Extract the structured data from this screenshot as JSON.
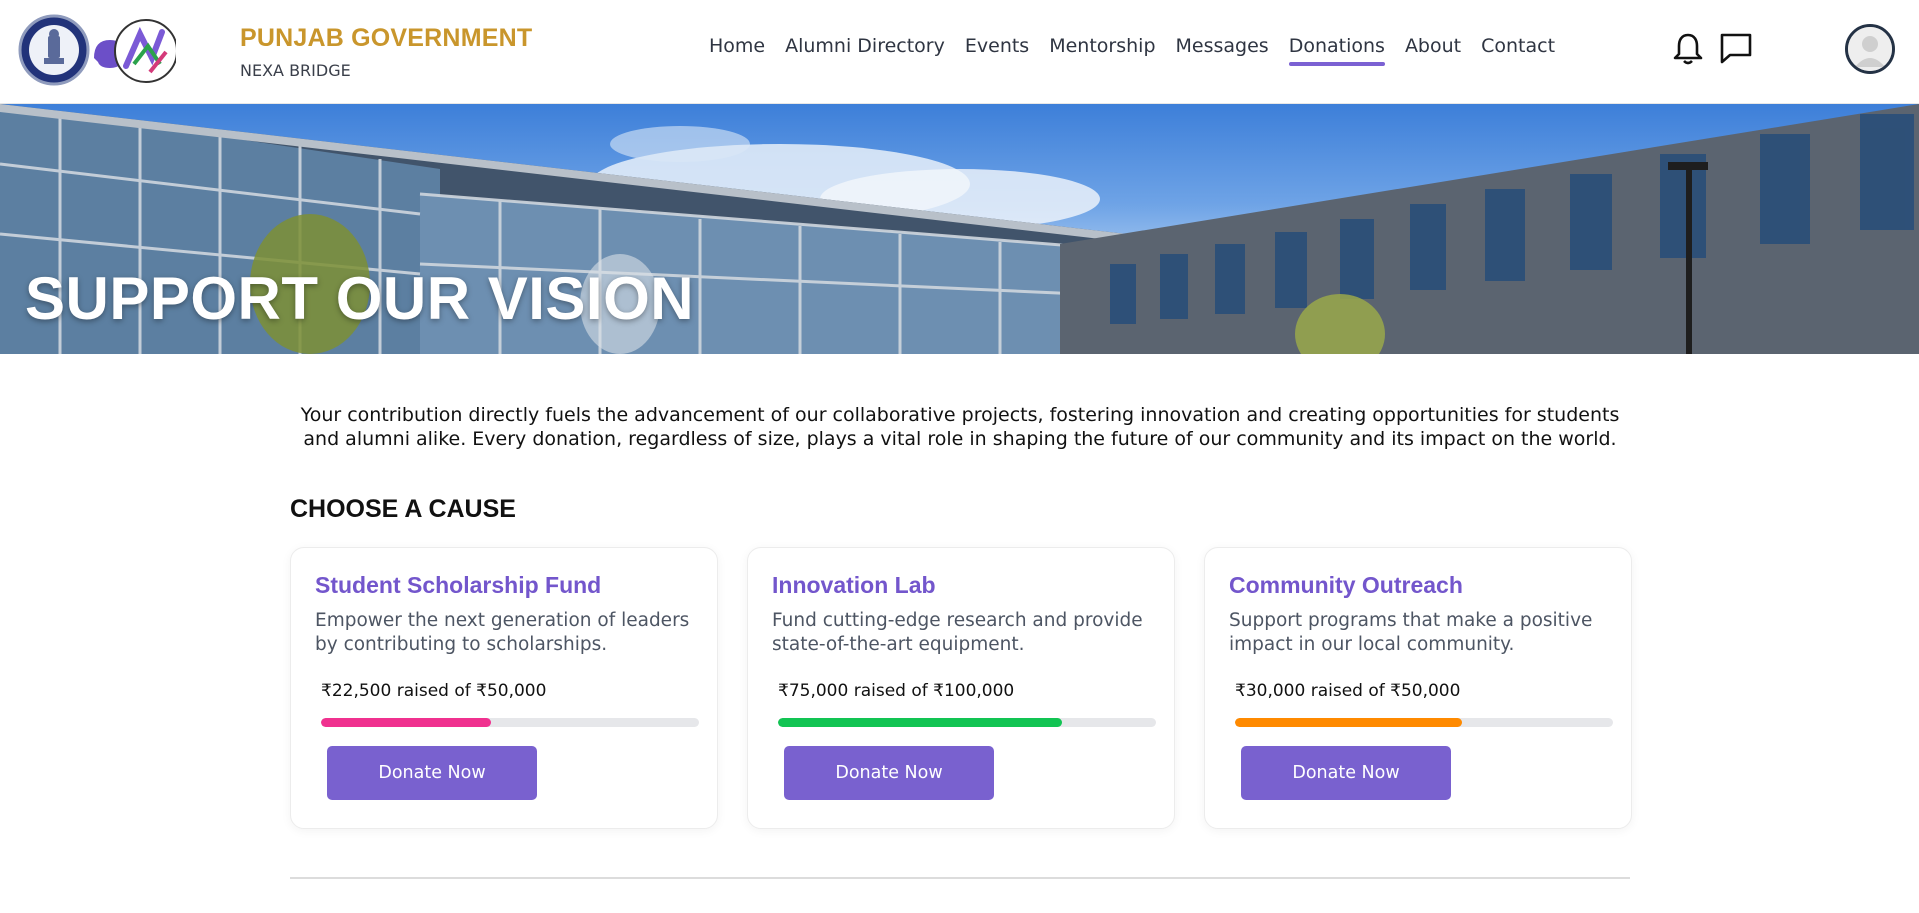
{
  "header": {
    "brand_title": "PUNJAB GOVERNMENT",
    "brand_subtitle": "NEXA BRIDGE",
    "nav": [
      {
        "label": "Home"
      },
      {
        "label": "Alumni Directory"
      },
      {
        "label": "Events"
      },
      {
        "label": "Mentorship"
      },
      {
        "label": "Messages"
      },
      {
        "label": "Donations",
        "active": true
      },
      {
        "label": "About"
      },
      {
        "label": "Contact"
      }
    ],
    "icons": [
      "emblem-logo-icon",
      "nexa-logo-icon",
      "bell-icon",
      "chat-icon",
      "user-avatar-icon"
    ]
  },
  "hero": {
    "title": "SUPPORT OUR VISION"
  },
  "intro": "Your contribution directly fuels the advancement of our collaborative projects, fostering innovation and creating opportunities for students and alumni alike. Every donation, regardless of size, plays a vital role in shaping the future of our community and its impact on the world.",
  "causes": {
    "heading": "CHOOSE A CAUSE",
    "items": [
      {
        "title": "Student Scholarship Fund",
        "description": "Empower the next generation of leaders by contributing to scholarships.",
        "raised_text": "₹22,500 raised of ₹50,000",
        "progress": 0.45,
        "bar_color": "#F0318F",
        "button": "Donate Now"
      },
      {
        "title": "Innovation Lab",
        "description": "Fund cutting-edge research and provide state-of-the-art equipment.",
        "raised_text": "₹75,000 raised of ₹100,000",
        "progress": 0.75,
        "bar_color": "#12C453",
        "button": "Donate Now"
      },
      {
        "title": "Community Outreach",
        "description": "Support programs that make a positive impact in our local community.",
        "raised_text": "₹30,000 raised of ₹50,000",
        "progress": 0.6,
        "bar_color": "#FF8A00",
        "button": "Donate Now"
      }
    ]
  },
  "colors": {
    "brand_gold": "#C9962C",
    "accent_purple": "#7961CF",
    "title_purple": "#7356CC"
  }
}
